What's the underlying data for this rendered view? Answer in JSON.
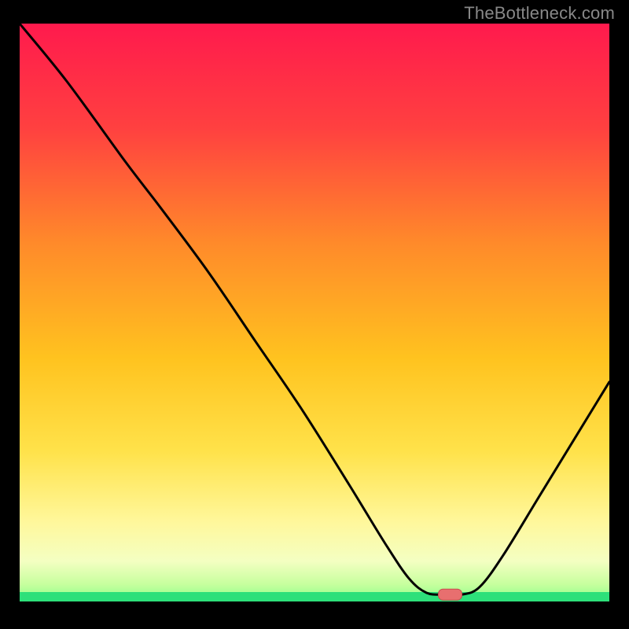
{
  "watermark": "TheBottleneck.com",
  "colors": {
    "frame_bg": "#000000",
    "line": "#000000",
    "marker_fill": "#e86f6f",
    "marker_stroke": "#c94d4d",
    "green_band": "#2de07a",
    "grad_top": "#ff1a4d",
    "grad_mid1": "#ff6633",
    "grad_mid2": "#ffcc33",
    "grad_mid3": "#ffee66",
    "grad_mid4": "#fff6b3",
    "grad_bottom": "#d7ffa8"
  },
  "chart_data": {
    "type": "line",
    "title": "",
    "xlabel": "",
    "ylabel": "",
    "xlim": [
      0,
      100
    ],
    "ylim": [
      0,
      100
    ],
    "curve": [
      {
        "x": 0,
        "y": 100
      },
      {
        "x": 8,
        "y": 90
      },
      {
        "x": 18,
        "y": 76
      },
      {
        "x": 24,
        "y": 68
      },
      {
        "x": 32,
        "y": 57
      },
      {
        "x": 40,
        "y": 45
      },
      {
        "x": 48,
        "y": 33
      },
      {
        "x": 56,
        "y": 20
      },
      {
        "x": 62,
        "y": 10
      },
      {
        "x": 66,
        "y": 4
      },
      {
        "x": 69,
        "y": 1.5
      },
      {
        "x": 72,
        "y": 1.2
      },
      {
        "x": 75,
        "y": 1.2
      },
      {
        "x": 78,
        "y": 2.5
      },
      {
        "x": 82,
        "y": 8
      },
      {
        "x": 88,
        "y": 18
      },
      {
        "x": 94,
        "y": 28
      },
      {
        "x": 100,
        "y": 38
      }
    ],
    "marker": {
      "x": 73,
      "y": 1.2
    }
  }
}
